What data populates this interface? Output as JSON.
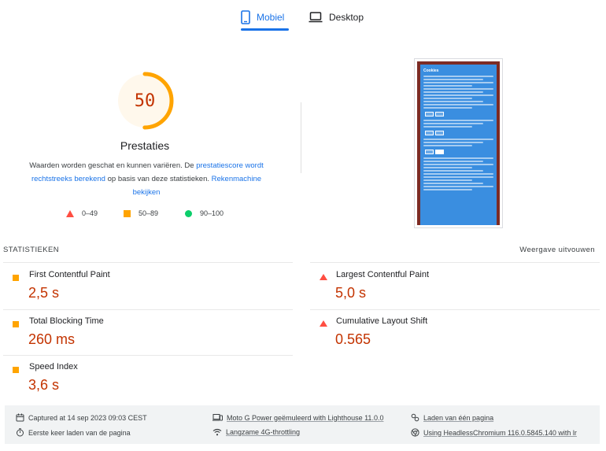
{
  "tabs": {
    "mobile_label": "Mobiel",
    "desktop_label": "Desktop",
    "active": "mobile"
  },
  "category": {
    "score": "50",
    "score_fraction": 0.5,
    "title": "Prestaties",
    "desc_part1": "Waarden worden geschat en kunnen variëren. De ",
    "desc_link1": "prestatiescore wordt rechtstreeks berekend",
    "desc_part2": " op basis van deze statistieken. ",
    "desc_link2": "Rekenmachine bekijken",
    "gauge_color": "#ffa400",
    "score_color": "#c33300"
  },
  "legend": {
    "fail": "0–49",
    "average": "50–89",
    "pass": "90–100"
  },
  "screenshot": {
    "title": "Cookies"
  },
  "stats": {
    "title": "STATISTIEKEN",
    "toggle": "Weergave uitvouwen",
    "metrics": [
      {
        "label": "First Contentful Paint",
        "value": "2,5 s",
        "rating": "average"
      },
      {
        "label": "Largest Contentful Paint",
        "value": "5,0 s",
        "rating": "fail"
      },
      {
        "label": "Total Blocking Time",
        "value": "260 ms",
        "rating": "average"
      },
      {
        "label": "Cumulative Layout Shift",
        "value": "0.565",
        "rating": "fail"
      },
      {
        "label": "Speed Index",
        "value": "3,6 s",
        "rating": "average"
      }
    ]
  },
  "footer": {
    "captured": "Captured at 14 sep 2023 09:03 CEST",
    "device": "Moto G Power geëmuleerd with Lighthouse 11.0.0",
    "session": "Laden van één pagina",
    "first_load": "Eerste keer laden van de pagina",
    "throttling": "Langzame 4G-throttling",
    "browser": "Using HeadlessChromium 116.0.5845.140 with lr"
  },
  "colors": {
    "accent": "#1a73e8",
    "fail": "#ff4e42",
    "average": "#ffa400",
    "pass": "#0cce6b",
    "value_text": "#c33300"
  }
}
